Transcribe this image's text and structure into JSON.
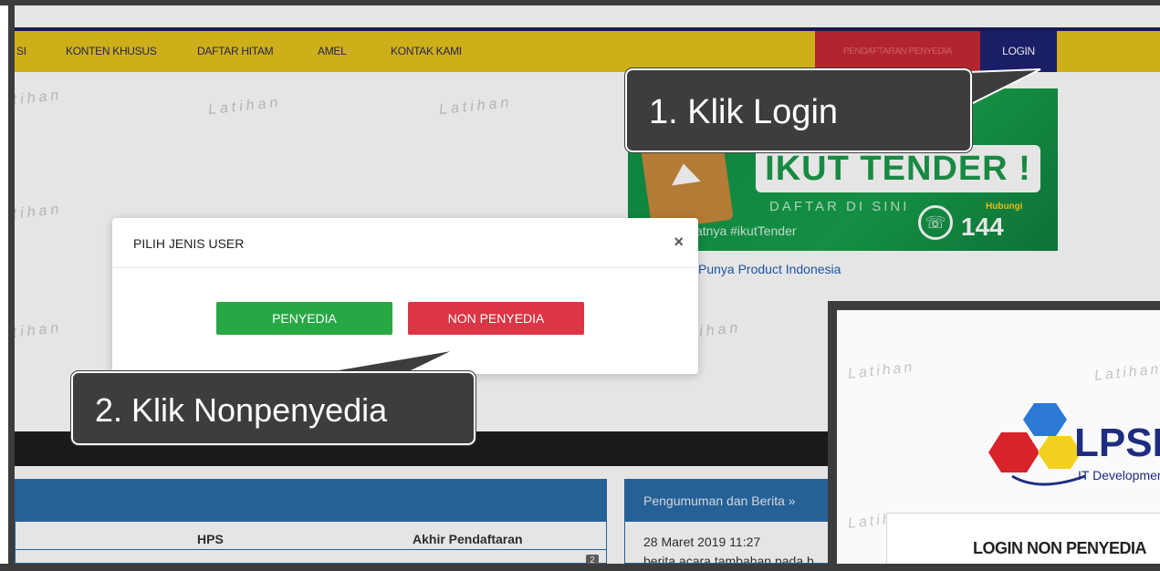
{
  "navbar": {
    "items": [
      {
        "label": "SI"
      },
      {
        "label": "KONTEN KHUSUS"
      },
      {
        "label": "DAFTAR HITAM"
      },
      {
        "label": "AMEL"
      },
      {
        "label": "KONTAK KAMI"
      }
    ],
    "register_label": "PENDAFTARAN PENYEDIA",
    "login_label": "LOGIN"
  },
  "watermark_text": "Latihan",
  "banner": {
    "headline": "IKUT TENDER !",
    "subline": "DAFTAR DI SINI",
    "tagline": "atnya #ikutTender",
    "hubungi": "Hubungi",
    "phone": "144"
  },
  "product_link": "Punya Product Indonesia",
  "modal": {
    "title": "PILIH JENIS USER",
    "close": "×",
    "penyedia_label": "PENYEDIA",
    "non_penyedia_label": "NON PENYEDIA"
  },
  "callouts": {
    "step1": "1. Klik Login",
    "step2": "2. Klik Nonpenyedia"
  },
  "table": {
    "col_hps": "HPS",
    "col_akhir": "Akhir Pendaftaran",
    "badge": "2"
  },
  "news": {
    "heading": "Pengumuman dan Berita »",
    "date": "28 Maret 2019 11:27",
    "text": "berita acara tambahan pada b"
  },
  "inset": {
    "logo_text": "LPSE",
    "logo_sub": "IT Development",
    "login_title": "LOGIN NON PENYEDIA"
  },
  "colors": {
    "navbar": "#e6c31c",
    "login_nav": "#1e2272",
    "register_nav": "#c72a35",
    "penyedia": "#28a745",
    "non_penyedia": "#dc3545",
    "callout": "#3d3d3d"
  }
}
